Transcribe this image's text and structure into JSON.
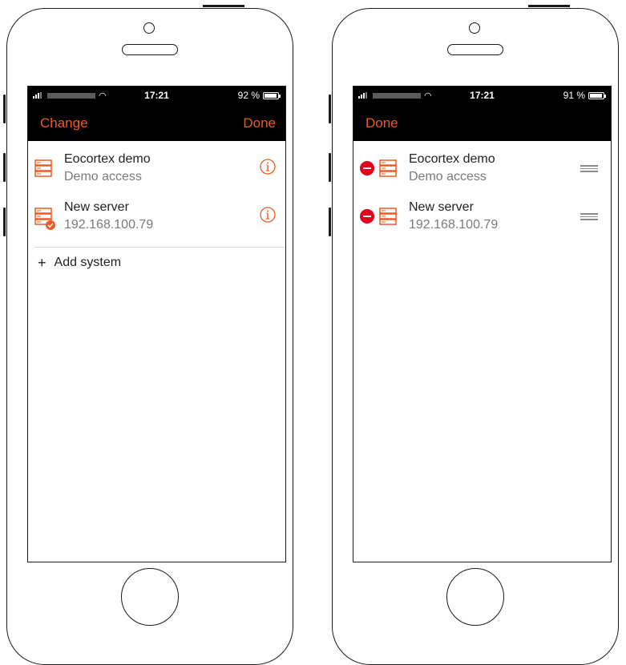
{
  "colors": {
    "accent": "#f05a22",
    "delete": "#e3001b",
    "statusbar": "#000000"
  },
  "left_screen": {
    "status": {
      "time": "17:21",
      "battery": "92 %",
      "battery_level": 0.92
    },
    "navbar": {
      "left_label": "Change",
      "right_label": "Done"
    },
    "servers": [
      {
        "title": "Eocortex demo",
        "subtitle": "Demo access",
        "icon": "server-icon",
        "connected": false,
        "action_icon": "info-icon"
      },
      {
        "title": "New server",
        "subtitle": "192.168.100.79",
        "icon": "server-icon",
        "connected": true,
        "action_icon": "info-icon"
      }
    ],
    "add_system_label": "Add system",
    "add_icon": "+"
  },
  "right_screen": {
    "status": {
      "time": "17:21",
      "battery": "91 %",
      "battery_level": 0.91
    },
    "navbar": {
      "left_label": "Done"
    },
    "servers": [
      {
        "title": "Eocortex demo",
        "subtitle": "Demo access",
        "icon": "server-icon",
        "action_icon": "drag-handle-icon"
      },
      {
        "title": "New server",
        "subtitle": "192.168.100.79",
        "icon": "server-icon",
        "action_icon": "drag-handle-icon"
      }
    ]
  }
}
